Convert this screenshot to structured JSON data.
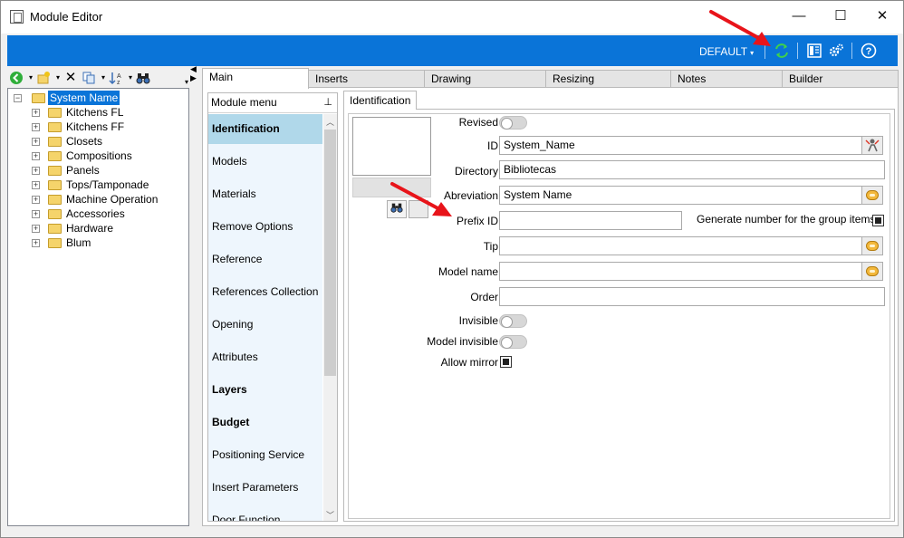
{
  "window": {
    "title": "Module Editor",
    "minimize": "—",
    "maximize": "☐",
    "close": "✕"
  },
  "toolbar": {
    "profile": "DEFAULT",
    "profile_caret": "▾"
  },
  "tree": {
    "toolbar_icons": [
      "back-icon",
      "new-icon",
      "delete-icon",
      "copy-icon",
      "sort-icon",
      "find-icon"
    ],
    "root": "System Name",
    "items": [
      "Kitchens FL",
      "Kitchens FF",
      "Closets",
      "Compositions",
      "Panels",
      "Tops/Tamponade",
      "Machine Operation",
      "Accessories",
      "Hardware",
      "Blum"
    ]
  },
  "tabs": [
    "Main",
    "Inserts",
    "Drawing",
    "Resizing",
    "Notes",
    "Builder"
  ],
  "module_menu": {
    "header": "Module menu",
    "pin": "⊥",
    "items": [
      {
        "label": "Identification"
      },
      {
        "label": "Models"
      },
      {
        "label": "Materials"
      },
      {
        "label": "Remove Options"
      },
      {
        "label": "Reference"
      },
      {
        "label": "References Collection"
      },
      {
        "label": "Opening"
      },
      {
        "label": "Attributes"
      },
      {
        "label": "Layers"
      },
      {
        "label": "Budget"
      },
      {
        "label": "Positioning Service"
      },
      {
        "label": "Insert Parameters"
      },
      {
        "label": "Door Function"
      }
    ]
  },
  "identification": {
    "tab_label": "Identification",
    "labels": {
      "revised": "Revised",
      "id": "ID",
      "directory": "Directory",
      "abreviation": "Abreviation",
      "prefix_id": "Prefix ID",
      "generate": "Generate number for the group items",
      "tip": "Tip",
      "model_name": "Model name",
      "order": "Order",
      "invisible": "Invisible",
      "model_invisible": "Model invisible",
      "allow_mirror": "Allow mirror"
    },
    "values": {
      "id": "System_Name",
      "directory": "Bibliotecas",
      "abreviation": "System Name",
      "prefix_id": "",
      "tip": "",
      "model_name": "",
      "order": ""
    }
  },
  "colors": {
    "accent": "#0A74D8",
    "menu_active": "#B0D8EA",
    "annotation": "#E8141A"
  }
}
